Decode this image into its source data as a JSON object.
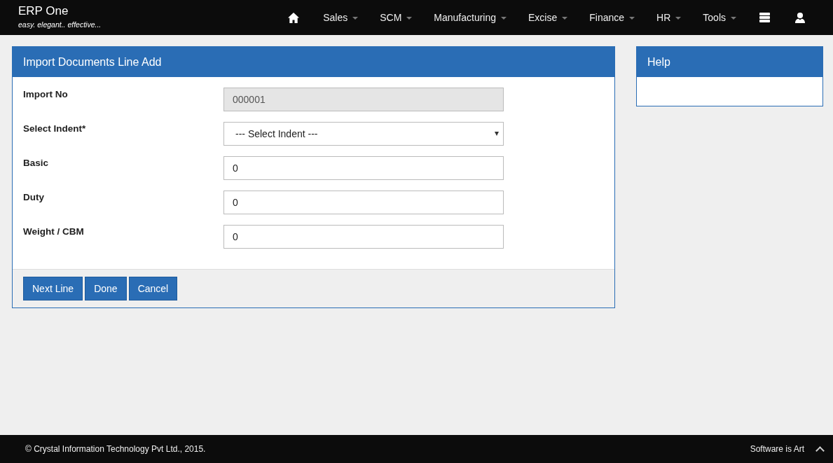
{
  "brand": {
    "title": "ERP One",
    "tagline": "easy. elegant.. effective..."
  },
  "nav": [
    {
      "kind": "home"
    },
    {
      "kind": "menu",
      "label": "Sales"
    },
    {
      "kind": "menu",
      "label": "SCM"
    },
    {
      "kind": "menu",
      "label": "Manufacturing"
    },
    {
      "kind": "menu",
      "label": "Excise"
    },
    {
      "kind": "menu",
      "label": "Finance"
    },
    {
      "kind": "menu",
      "label": "HR"
    },
    {
      "kind": "menu",
      "label": "Tools"
    },
    {
      "kind": "server"
    },
    {
      "kind": "user"
    }
  ],
  "form": {
    "title": "Import Documents Line Add",
    "fields": [
      {
        "kind": "readonly",
        "label": "Import No",
        "value": "000001"
      },
      {
        "kind": "select",
        "label": "Select Indent*",
        "value": "--- Select Indent ---"
      },
      {
        "kind": "text",
        "label": "Basic",
        "value": "0"
      },
      {
        "kind": "text",
        "label": "Duty",
        "value": "0"
      },
      {
        "kind": "text",
        "label": "Weight / CBM",
        "value": "0"
      }
    ],
    "buttons": [
      "Next Line",
      "Done",
      "Cancel"
    ]
  },
  "help": {
    "title": "Help"
  },
  "footer": {
    "copyright": "© Crystal Information Technology Pvt Ltd., 2015.",
    "tagline": "Software is Art"
  }
}
